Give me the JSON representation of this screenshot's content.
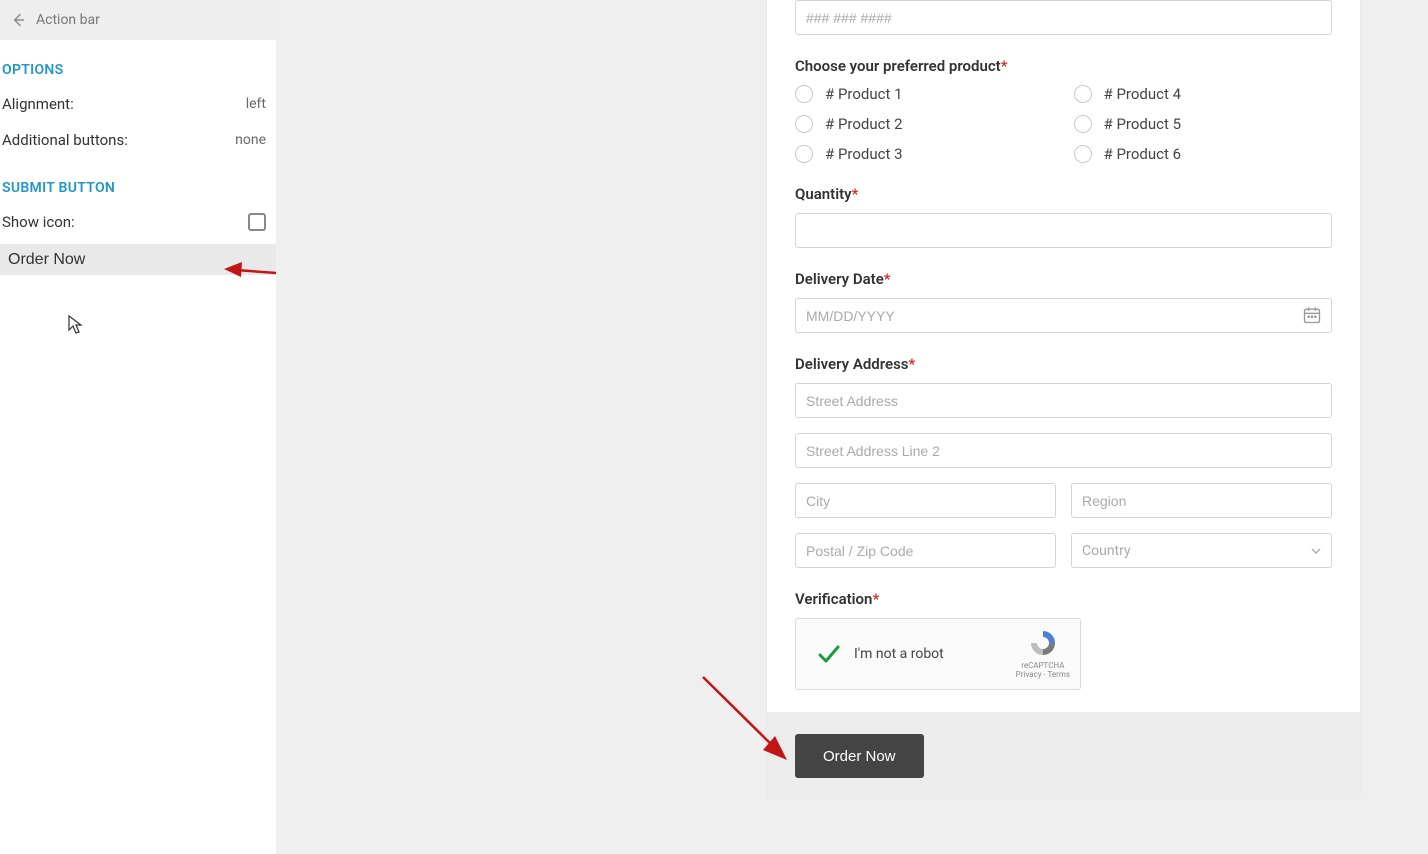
{
  "sidebar": {
    "header_title": "Action bar",
    "section_options": "OPTIONS",
    "alignment_label": "Alignment:",
    "alignment_value": "left",
    "additional_buttons_label": "Additional buttons:",
    "additional_buttons_value": "none",
    "section_submit": "SUBMIT BUTTON",
    "show_icon_label": "Show icon:",
    "button_text_value": "Order Now"
  },
  "form": {
    "phone_placeholder": "### ### ####",
    "product_label": "Choose your preferred product",
    "products": [
      "# Product 1",
      "# Product 2",
      "# Product 3",
      "# Product 4",
      "# Product 5",
      "# Product 6"
    ],
    "quantity_label": "Quantity",
    "delivery_date_label": "Delivery Date",
    "delivery_date_placeholder": "MM/DD/YYYY",
    "delivery_address_label": "Delivery Address",
    "address_street_placeholder": "Street Address",
    "address_street2_placeholder": "Street Address Line 2",
    "address_city_placeholder": "City",
    "address_region_placeholder": "Region",
    "address_postal_placeholder": "Postal / Zip Code",
    "address_country_placeholder": "Country",
    "verification_label": "Verification",
    "captcha_label": "I'm not a robot",
    "captcha_brand": "reCAPTCHA",
    "captcha_terms": "Privacy - Terms",
    "submit_label": "Order Now"
  }
}
